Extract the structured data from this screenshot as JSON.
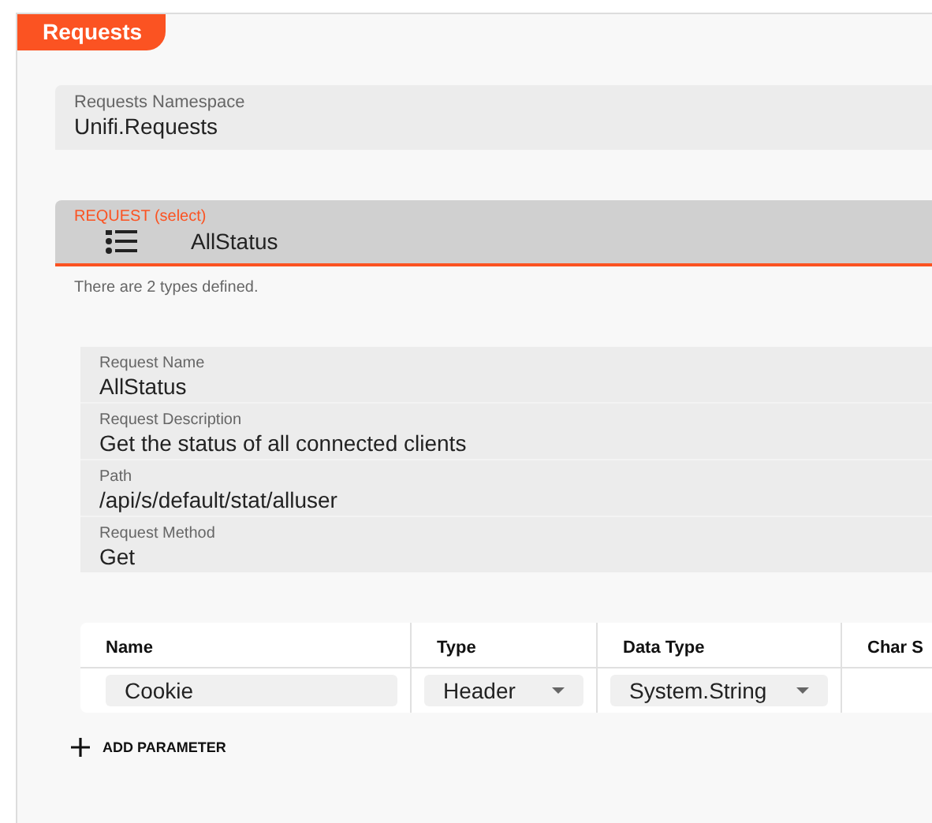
{
  "tab": {
    "label": "Requests"
  },
  "namespace": {
    "label": "Requests Namespace",
    "value": "Unifi.Requests"
  },
  "request_select": {
    "label": "REQUEST (select)",
    "value": "AllStatus",
    "helper": "There are 2 types defined."
  },
  "fields": [
    {
      "label": "Request Name",
      "value": "AllStatus"
    },
    {
      "label": "Request Description",
      "value": "Get the status of all connected clients"
    },
    {
      "label": "Path",
      "value": "/api/s/default/stat/alluser"
    },
    {
      "label": "Request Method",
      "value": "Get"
    }
  ],
  "table": {
    "columns": [
      "Name",
      "Type",
      "Data Type",
      "Char S"
    ],
    "rows": [
      {
        "name": "Cookie",
        "type": "Header",
        "data_type": "System.String"
      }
    ]
  },
  "add_button": {
    "label": "ADD PARAMETER"
  }
}
